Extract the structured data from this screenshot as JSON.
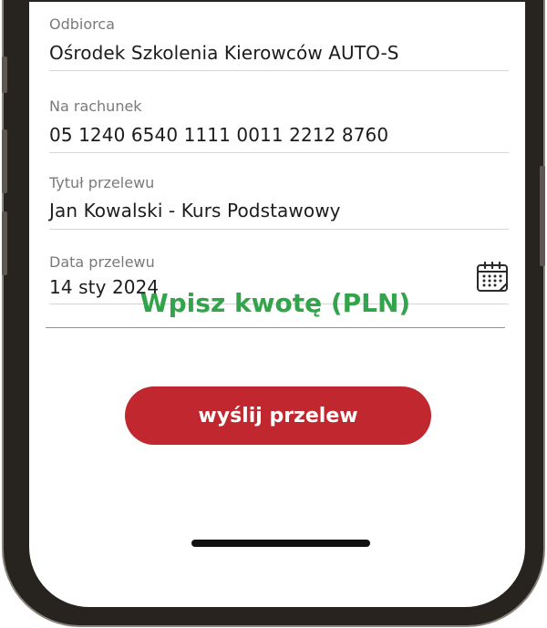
{
  "form": {
    "recipient": {
      "label": "Odbiorca",
      "value": "Ośrodek Szkolenia Kierowców AUTO-S"
    },
    "account": {
      "label": "Na rachunek",
      "value": "05 1240 6540 1111 0011 2212 8760"
    },
    "title": {
      "label": "Tytuł przelewu",
      "value": "Jan Kowalski - Kurs Podstawowy"
    },
    "date": {
      "label": "Data przelewu",
      "value": "14 sty 2024",
      "icon": "calendar-icon"
    },
    "amount_placeholder": "Wpisz kwotę (PLN)",
    "submit_label": "wyślij przelew"
  },
  "colors": {
    "accent_green": "#33a44b",
    "button_red": "#c1272f",
    "frame": "#27231f"
  }
}
